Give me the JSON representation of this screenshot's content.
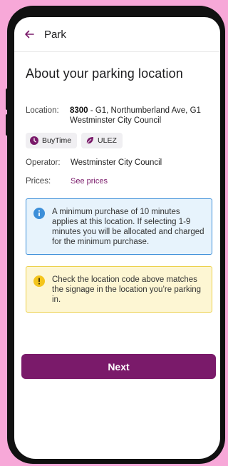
{
  "header": {
    "title": "Park"
  },
  "page": {
    "heading": "About your parking location"
  },
  "location": {
    "label": "Location:",
    "code": "8300",
    "address": " - G1, Northumberland Ave, G1",
    "council": "Westminster City Council"
  },
  "tags": [
    {
      "label": "BuyTime",
      "icon": "clock-icon",
      "color": "#7a1a6a"
    },
    {
      "label": "ULEZ",
      "icon": "leaf-icon",
      "color": "#7a1a6a"
    }
  ],
  "operator": {
    "label": "Operator:",
    "value": "Westminster City Council"
  },
  "prices": {
    "label": "Prices:",
    "link": "See prices"
  },
  "info_notice": {
    "icon": "info-icon",
    "color": "#3d8fd9",
    "text": "A minimum purchase of 10 minutes applies at this location. If selecting 1-9 minutes you will be allocated and charged for the minimum purchase."
  },
  "warning_notice": {
    "icon": "warning-icon",
    "color": "#f4c51c",
    "text": "Check the location code above matches the signage in the location you’re parking in."
  },
  "next_button": {
    "label": "Next",
    "color": "#7a1a6a"
  }
}
